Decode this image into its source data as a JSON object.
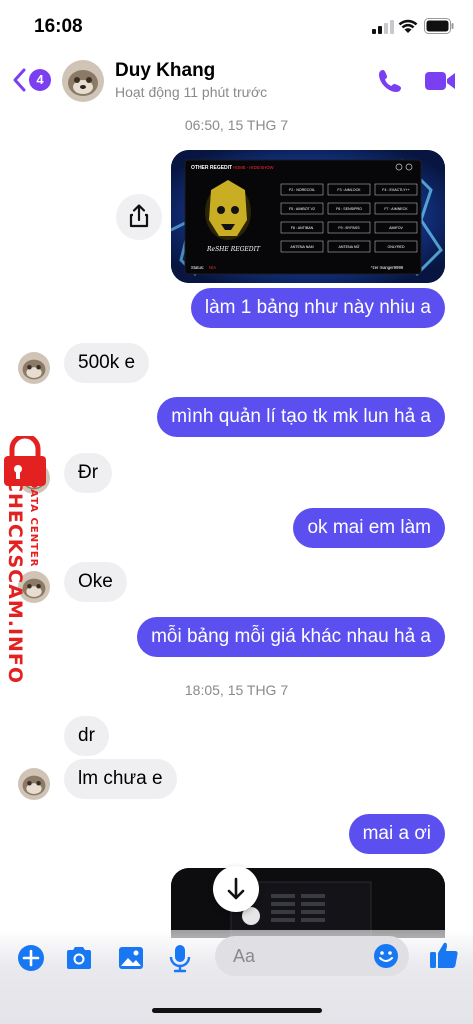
{
  "status_bar": {
    "time": "16:08"
  },
  "header": {
    "back_badge": "4",
    "contact_name": "Duy Khang",
    "contact_status": "Hoạt động 11 phút trước",
    "call_icon": "phone-icon",
    "video_icon": "video-camera-icon"
  },
  "conversation": {
    "timestamps": [
      "06:50, 15 THG 7",
      "18:05, 15 THG 7"
    ],
    "image_panel": {
      "title": "OTHER REGEDIT",
      "subtitle": "HOME - HIDE/SHOW",
      "buttons": [
        "F2 : NORECOIL",
        "F3 : AIMLOCK",
        "F4 : EXACTLY++",
        "F5 : AIMBOT V2",
        "F6 : SENSIPRO",
        "F7 : AIMNECK",
        "F8 : ANTIBAN",
        "F9 : BYPASS",
        "AIMFOV",
        "ANTENA NAM",
        "ANTENA NỮ",
        "ONLYRED"
      ],
      "logo_text": "ReSHE REGEDIT",
      "status_label": "Status:",
      "status_value": "N/A",
      "footer": "*zer manger9999"
    },
    "messages": [
      {
        "dir": "out",
        "text": "làm 1 bảng như này nhiu a"
      },
      {
        "dir": "in",
        "text": "500k e"
      },
      {
        "dir": "out",
        "text": "mình quản lí tạo tk mk lun hả a"
      },
      {
        "dir": "in",
        "text": "Đr"
      },
      {
        "dir": "out",
        "text": "ok  mai em làm"
      },
      {
        "dir": "in",
        "text": "Oke"
      },
      {
        "dir": "out",
        "text": "mỗi bảng mỗi giá khác nhau hả a"
      },
      {
        "dir": "in",
        "text": "dr"
      },
      {
        "dir": "in",
        "text": "lm chưa e"
      },
      {
        "dir": "out",
        "text": "mai a ơi"
      }
    ]
  },
  "watermark": {
    "main": "CHECKSCAM.INFO",
    "sub": "DATA CENTER"
  },
  "composer": {
    "placeholder": "Aa"
  },
  "colors": {
    "accent": "#7b3ff2",
    "outgoing_bubble": "#5b4ff0",
    "incoming_bubble": "#efeff1",
    "composer_icon": "#1877f2"
  }
}
